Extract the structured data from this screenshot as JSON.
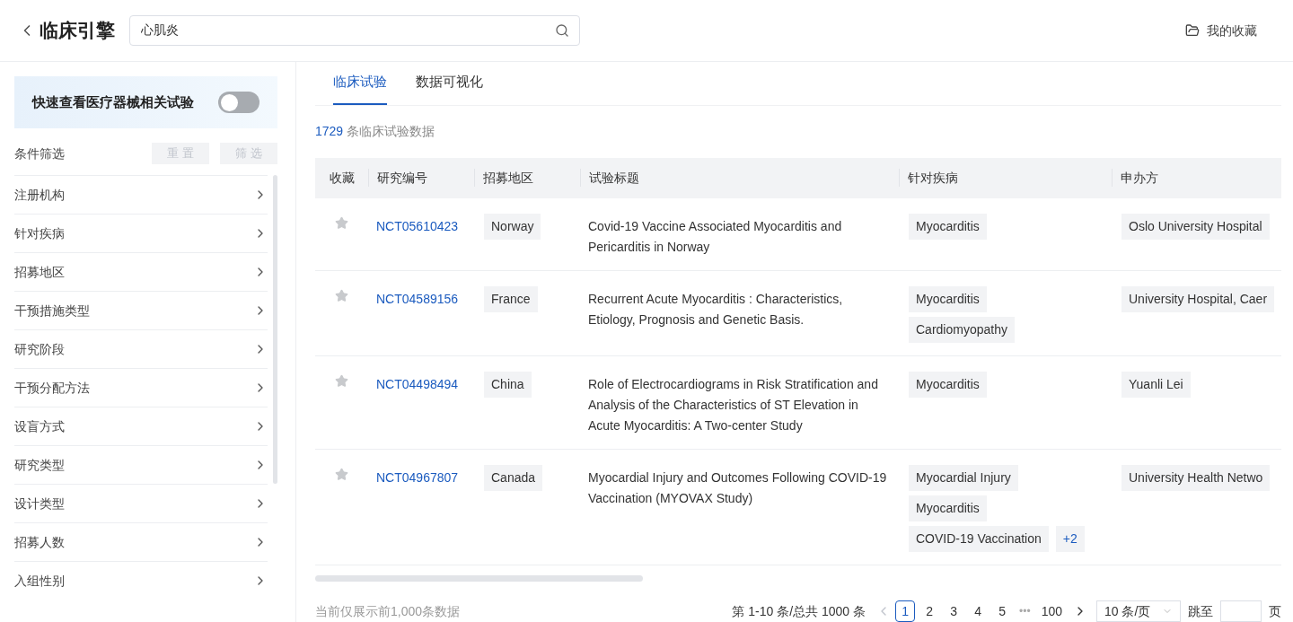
{
  "header": {
    "title": "临床引擎",
    "search": {
      "value": "心肌炎"
    },
    "favorites_link": "我的收藏"
  },
  "sidebar": {
    "device_toggle": {
      "label": "快速查看医疗器械相关试验",
      "on": false
    },
    "filter_title": "条件筛选",
    "buttons": [
      {
        "label": "重 置",
        "disabled": true
      },
      {
        "label": "筛 选",
        "disabled": true
      }
    ],
    "filters": [
      "注册机构",
      "针对疾病",
      "招募地区",
      "干预措施类型",
      "研究阶段",
      "干预分配方法",
      "设盲方式",
      "研究类型",
      "设计类型",
      "招募人数",
      "入组性别"
    ]
  },
  "tabs": [
    {
      "label": "临床试验",
      "selected": true
    },
    {
      "label": "数据可视化",
      "selected": false
    }
  ],
  "result_count": {
    "number": "1729",
    "label": "条临床试验数据"
  },
  "table": {
    "columns": [
      "收藏",
      "研究编号",
      "招募地区",
      "试验标题",
      "针对疾病",
      "申办方"
    ],
    "rows": [
      {
        "starred": false,
        "id": "NCT05610423",
        "region": "Norway",
        "title": "Covid-19 Vaccine Associated Myocarditis and Pericarditis in Norway",
        "diseases": [
          "Myocarditis"
        ],
        "sponsor": "Oslo University Hospital"
      },
      {
        "starred": false,
        "id": "NCT04589156",
        "region": "France",
        "title": "Recurrent Acute Myocarditis : Characteristics, Etiology, Prognosis and Genetic Basis.",
        "diseases": [
          "Myocarditis",
          "Cardiomyopathy"
        ],
        "sponsor": "University Hospital, Caer"
      },
      {
        "starred": false,
        "id": "NCT04498494",
        "region": "China",
        "title": "Role of Electrocardiograms in Risk Stratification and Analysis of the Characteristics of ST Elevation in Acute Myocarditis: A Two-center Study",
        "diseases": [
          "Myocarditis"
        ],
        "sponsor": "Yuanli Lei"
      },
      {
        "starred": false,
        "id": "NCT04967807",
        "region": "Canada",
        "title": "Myocardial Injury and Outcomes Following COVID-19 Vaccination (MYOVAX Study)",
        "diseases": [
          "Myocardial Injury",
          "Myocarditis",
          "COVID-19 Vaccination"
        ],
        "more": "+2",
        "sponsor": "University Health Netwo"
      }
    ]
  },
  "footer_note": "当前仅展示前1,000条数据",
  "pagination": {
    "summary": "第 1-10 条/总共 1000 条",
    "prev_disabled": true,
    "pages": [
      {
        "label": "1",
        "selected": true
      },
      {
        "label": "2",
        "selected": false
      },
      {
        "label": "3",
        "selected": false
      },
      {
        "label": "4",
        "selected": false
      },
      {
        "label": "5",
        "selected": false
      }
    ],
    "ellipsis": "•••",
    "last_page": "100",
    "page_size": "10 条/页",
    "jump_label": "跳至",
    "jump_suffix": "页"
  }
}
